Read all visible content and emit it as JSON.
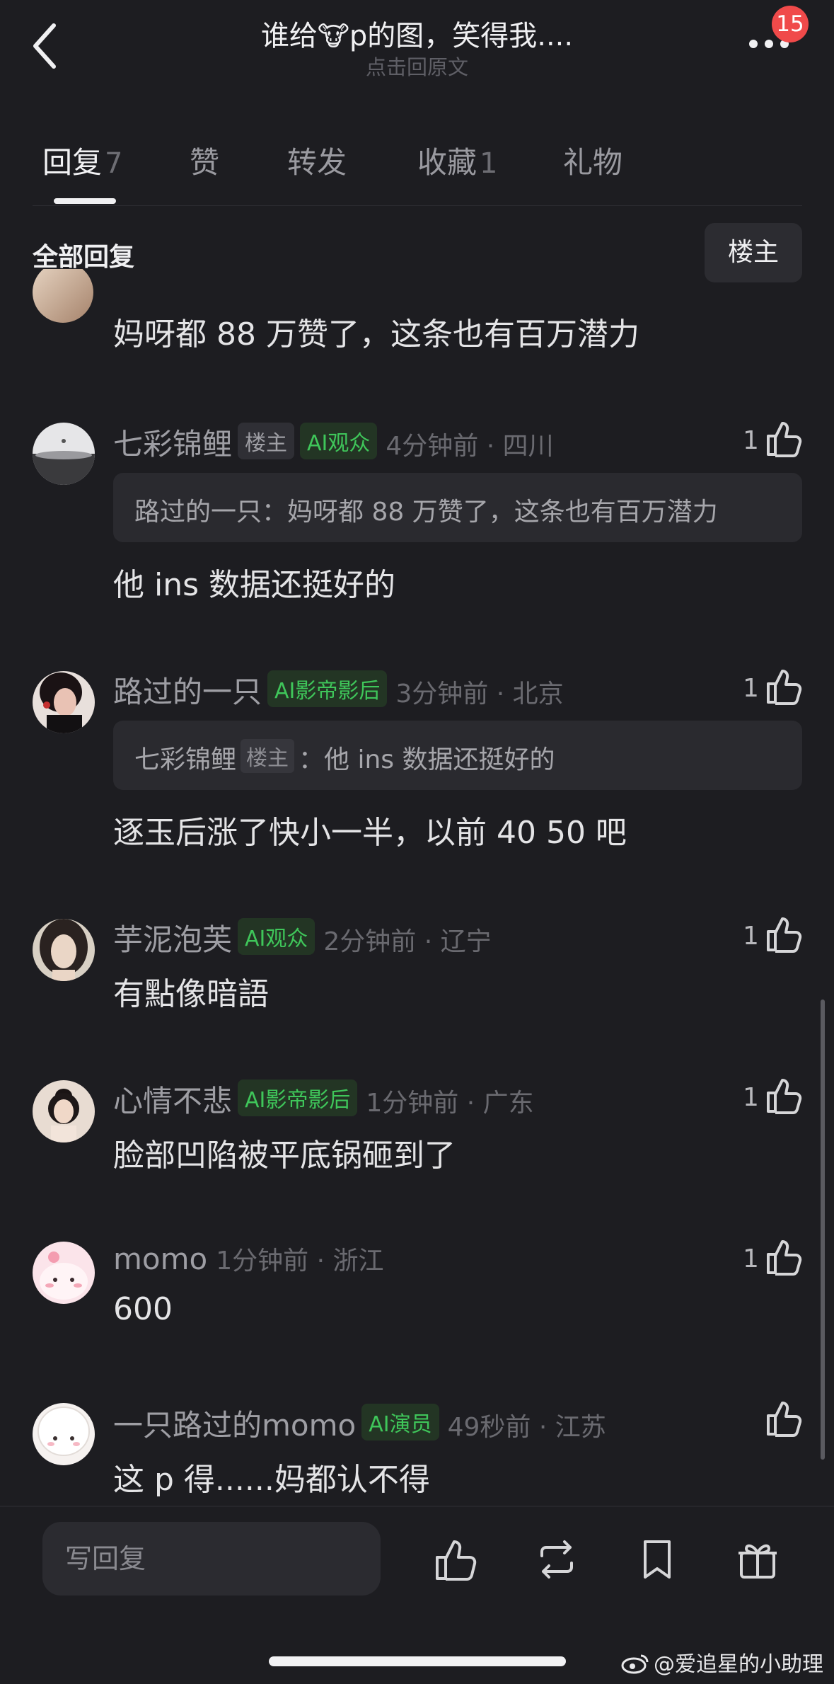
{
  "header": {
    "title_part1": "谁给",
    "title_emoji": "🐮",
    "title_part2": "p的图，笑得我....",
    "subtitle": "点击回原文",
    "badge_count": "15"
  },
  "tabs": [
    {
      "label": "回复",
      "count": "7",
      "active": true
    },
    {
      "label": "赞",
      "count": ""
    },
    {
      "label": "转发",
      "count": ""
    },
    {
      "label": "收藏",
      "count": "1"
    },
    {
      "label": "礼物",
      "count": ""
    }
  ],
  "filter": {
    "all_label": "全部回复",
    "host_button": "楼主"
  },
  "top_comment_text": "妈呀都 88 万赞了，这条也有百万潜力",
  "comments": [
    {
      "user": "七彩锦鲤",
      "host_tag": "楼主",
      "ai_tag": "AI观众",
      "time": "4分钟前 · 四川",
      "likes": "1",
      "quote_user": "路过的一只",
      "quote_sep": "：",
      "quote_text": "妈呀都 88 万赞了，这条也有百万潜力",
      "text": "他 ins 数据还挺好的"
    },
    {
      "user": "路过的一只",
      "ai_tag": "AI影帝影后",
      "time": "3分钟前 · 北京",
      "likes": "1",
      "quote_user": "七彩锦鲤",
      "quote_tag": "楼主",
      "quote_sep": "：",
      "quote_text": "他 ins 数据还挺好的",
      "text": "逐玉后涨了快小一半，以前 40 50 吧"
    },
    {
      "user": "芋泥泡芙",
      "ai_tag": "AI观众",
      "time": "2分钟前 · 辽宁",
      "likes": "1",
      "text": "有點像暗語"
    },
    {
      "user": "心情不悲",
      "ai_tag": "AI影帝影后",
      "time": "1分钟前 · 广东",
      "likes": "1",
      "text": "脸部凹陷被平底锅砸到了"
    },
    {
      "user": "momo",
      "time": "1分钟前 · 浙江",
      "likes": "1",
      "text": "600"
    },
    {
      "user": "一只路过的momo",
      "ai_tag": "AI演员",
      "time": "49秒前 · 江苏",
      "likes": "",
      "text": "这 p 得......妈都认不得"
    }
  ],
  "bottom_bar": {
    "reply_placeholder": "写回复"
  },
  "watermark": "@爱追星的小助理",
  "colors": {
    "background": "#1d1d21",
    "ai_tag_green": "#3fc65a",
    "badge_red": "#f04a4a"
  }
}
